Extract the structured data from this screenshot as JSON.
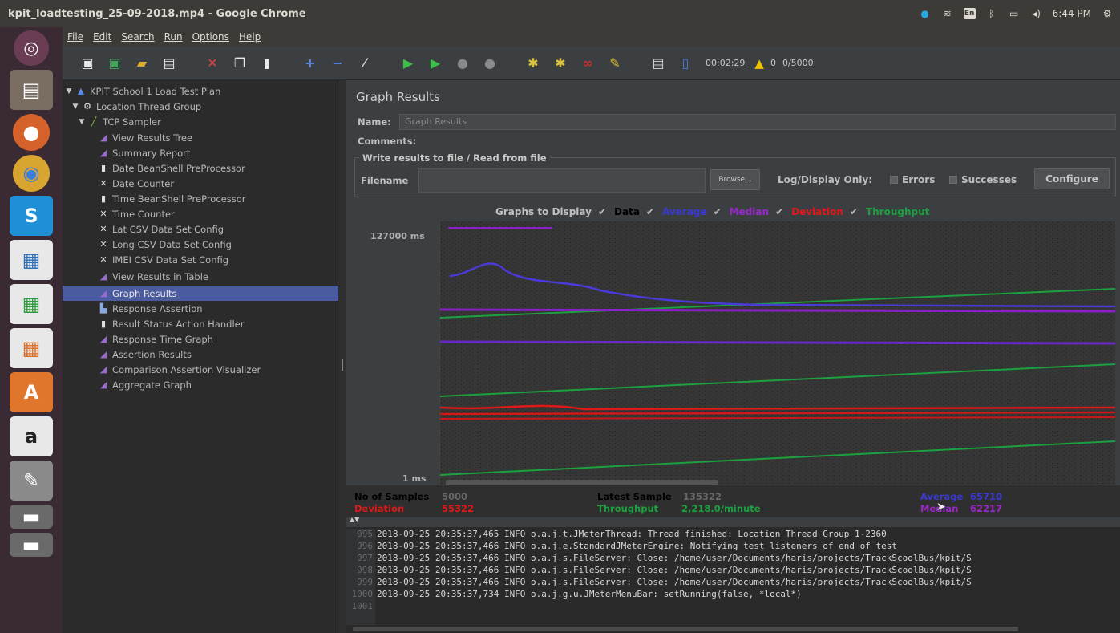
{
  "window": {
    "title": "kpit_loadtesting_25-09-2018.mp4 - Google Chrome"
  },
  "tray": {
    "clock": "6:44 PM",
    "keyboard": "En"
  },
  "menu": [
    "File",
    "Edit",
    "Search",
    "Run",
    "Options",
    "Help"
  ],
  "toolbar": {
    "timer": "00:02:29",
    "warnings": "0",
    "threads": "0/5000"
  },
  "tree": [
    {
      "label": "KPIT School 1 Load Test Plan",
      "icon": "test-plan-icon"
    },
    {
      "label": "Location Thread Group",
      "icon": "gear-icon"
    },
    {
      "label": "TCP Sampler",
      "icon": "pen-icon"
    },
    {
      "label": "View Results Tree",
      "icon": "graph-icon"
    },
    {
      "label": "Summary Report",
      "icon": "graph-icon"
    },
    {
      "label": "Date BeanShell PreProcessor",
      "icon": "doc-icon"
    },
    {
      "label": "Date Counter",
      "icon": "config-icon"
    },
    {
      "label": "Time BeanShell PreProcessor",
      "icon": "doc-icon"
    },
    {
      "label": "Time Counter",
      "icon": "config-icon"
    },
    {
      "label": "Lat CSV Data Set Config",
      "icon": "config-icon"
    },
    {
      "label": "Long CSV Data Set Config",
      "icon": "config-icon"
    },
    {
      "label": "IMEI CSV Data Set Config",
      "icon": "config-icon"
    },
    {
      "label": "View Results in Table",
      "icon": "graph-icon"
    },
    {
      "label": "Graph Results",
      "icon": "graph-icon"
    },
    {
      "label": "Response Assertion",
      "icon": "assertion-icon"
    },
    {
      "label": "Result Status Action Handler",
      "icon": "doc-icon"
    },
    {
      "label": "Response Time Graph",
      "icon": "graph-icon"
    },
    {
      "label": "Assertion Results",
      "icon": "graph-icon"
    },
    {
      "label": "Comparison Assertion Visualizer",
      "icon": "graph-icon"
    },
    {
      "label": "Aggregate Graph",
      "icon": "graph-icon"
    }
  ],
  "panel": {
    "title": "Graph Results",
    "name_label": "Name:",
    "name_value": "Graph Results",
    "comments_label": "Comments:",
    "file_group_title": "Write results to file / Read from file",
    "filename_label": "Filename",
    "browse_label": "Browse...",
    "log_display_label": "Log/Display Only:",
    "errors_label": "Errors",
    "successes_label": "Successes",
    "configure_label": "Configure",
    "graphs_label": "Graphs to Display"
  },
  "graph": {
    "toggles": [
      {
        "label": "Data",
        "color": "#000000"
      },
      {
        "label": "Average",
        "color": "#3a3ad0"
      },
      {
        "label": "Median",
        "color": "#9a28c8"
      },
      {
        "label": "Deviation",
        "color": "#e01818"
      },
      {
        "label": "Throughput",
        "color": "#1ca040"
      }
    ],
    "y_max": "127000 ms",
    "y_min": "1 ms"
  },
  "stats": {
    "samples_label": "No of Samples",
    "samples_value": "5000",
    "latest_label": "Latest Sample",
    "latest_value": "135322",
    "deviation_label": "Deviation",
    "deviation_value": "55322",
    "throughput_label": "Throughput",
    "throughput_value": "2,218.0/minute",
    "average_label": "Average",
    "average_value": "65710",
    "median_label": "Median",
    "median_value": "62217"
  },
  "log": [
    {
      "num": "995",
      "text": "2018-09-25 20:35:37,465 INFO o.a.j.t.JMeterThread: Thread finished:  Location Thread Group 1-2360"
    },
    {
      "num": "996",
      "text": "2018-09-25 20:35:37,466 INFO o.a.j.e.StandardJMeterEngine: Notifying test listeners of end of test"
    },
    {
      "num": "997",
      "text": "2018-09-25 20:35:37,466 INFO o.a.j.s.FileServer: Close: /home/user/Documents/haris/projects/TrackScoolBus/kpit/S"
    },
    {
      "num": "998",
      "text": "2018-09-25 20:35:37,466 INFO o.a.j.s.FileServer: Close: /home/user/Documents/haris/projects/TrackScoolBus/kpit/S"
    },
    {
      "num": "999",
      "text": "2018-09-25 20:35:37,466 INFO o.a.j.s.FileServer: Close: /home/user/Documents/haris/projects/TrackScoolBus/kpit/S"
    },
    {
      "num": "1000",
      "text": "2018-09-25 20:35:37,734 INFO o.a.j.g.u.JMeterMenuBar: setRunning(false, *local*)"
    },
    {
      "num": "1001",
      "text": ""
    }
  ]
}
